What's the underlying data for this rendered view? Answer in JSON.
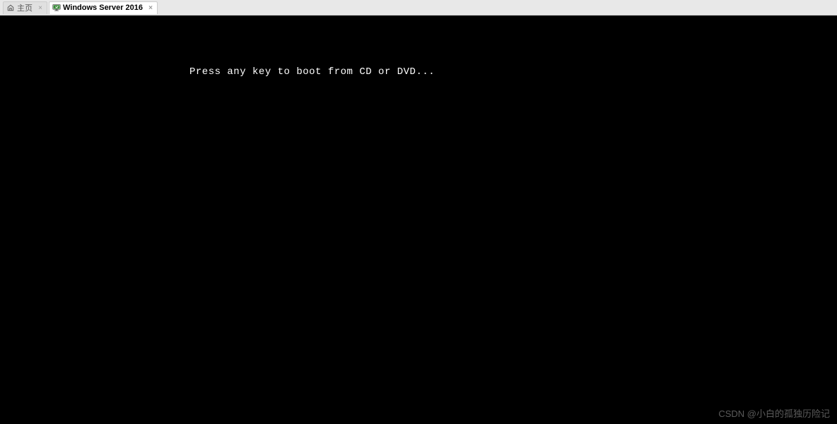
{
  "tabs": [
    {
      "label": "主页",
      "icon": "home",
      "active": false
    },
    {
      "label": "Windows Server 2016",
      "icon": "vm",
      "active": true
    }
  ],
  "console": {
    "boot_message": "Press any key to boot from CD or DVD..."
  },
  "watermark": "CSDN @小白的孤独历险记"
}
